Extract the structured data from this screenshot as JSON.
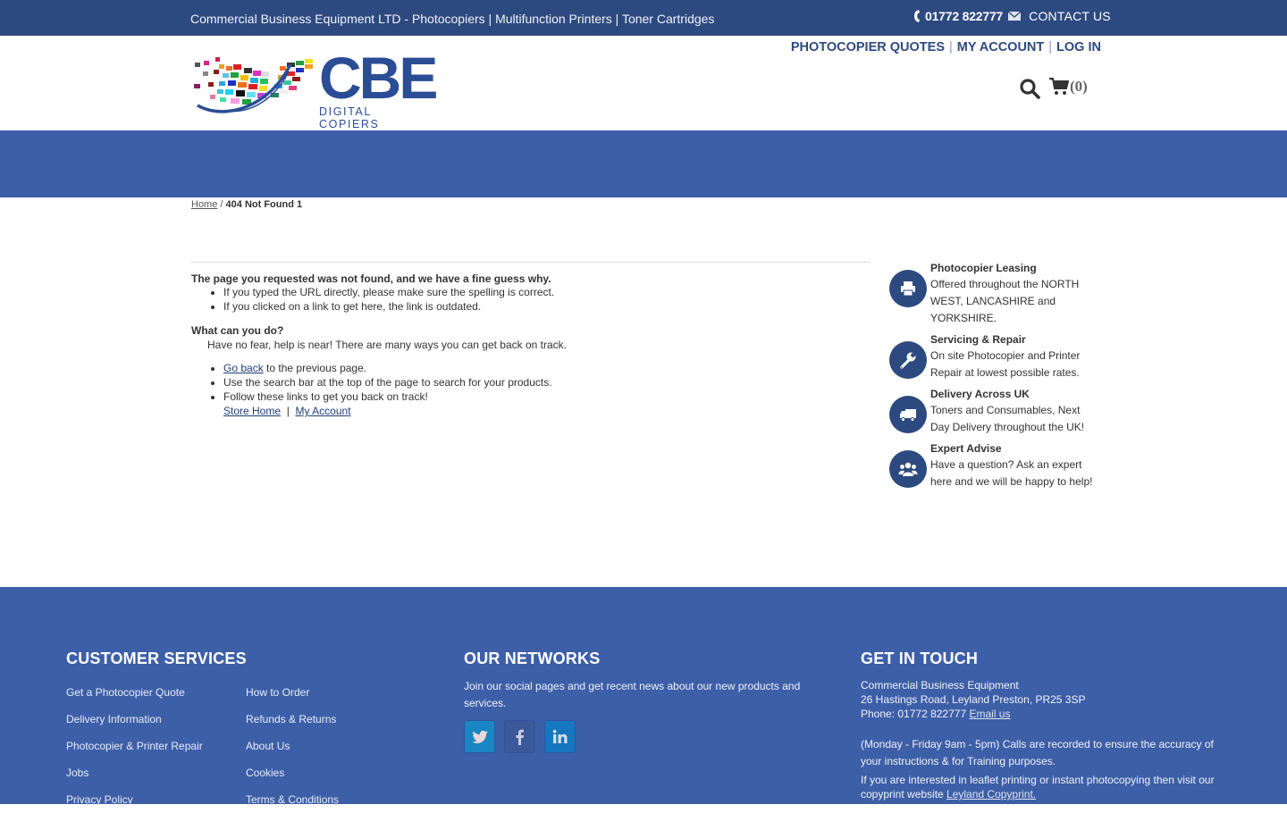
{
  "topbar": {
    "tagline": "Commercial Business Equipment LTD - Photocopiers | Multifunction Printers | Toner Cartridges",
    "phone": "01772 822777",
    "contact_label": "CONTACT US",
    "icons": {
      "phone": "phone-icon",
      "mail": "envelope-icon"
    }
  },
  "header": {
    "logo": {
      "brand": "CBE",
      "subtitle": "DIGITAL COPIERS"
    },
    "nav": [
      {
        "label": "PHOTOCOPIER QUOTES"
      },
      {
        "label": "MY ACCOUNT"
      },
      {
        "label": "LOG IN"
      }
    ],
    "separator": "|",
    "search_icon": "search-icon",
    "cart": {
      "icon": "shopping-cart-icon",
      "count": "(0)"
    }
  },
  "breadcrumb": {
    "home": "Home",
    "separator": "/",
    "current": "404 Not Found 1"
  },
  "main": {
    "heading": "The page you requested was not found, and we have a fine guess why.",
    "reasons": [
      "If you typed the URL directly, please make sure the spelling is correct.",
      "If you clicked on a link to get here, the link is outdated."
    ],
    "what_heading": "What can you do?",
    "help_text": "Have no fear, help is near! There are many ways you can get back on track.",
    "go_back_link": "Go back",
    "go_back_rest": " to the previous page.",
    "search_tip": "Use the search bar at the top of the page to search for your products.",
    "follow_tip": "Follow these links to get you back on track!",
    "store_home": "Store Home",
    "links_sep": "|",
    "my_account": "My Account"
  },
  "features": [
    {
      "icon": "printer-icon",
      "title": "Photocopier Leasing",
      "desc": "Offered throughout the NORTH WEST, LANCASHIRE and YORKSHIRE."
    },
    {
      "icon": "wrench-icon",
      "title": "Servicing & Repair",
      "desc": "On site Photocopier and Printer Repair at lowest possible rates."
    },
    {
      "icon": "truck-icon",
      "title": "Delivery Across UK",
      "desc": "Toners and Consumables, Next Day Delivery throughout the UK!"
    },
    {
      "icon": "users-icon",
      "title": "Expert Advise",
      "desc": "Have a question? Ask an expert here and we will be happy to help!"
    }
  ],
  "footer": {
    "customer_services": {
      "heading": "CUSTOMER SERVICES",
      "links": [
        "Get a Photocopier Quote",
        "How to Order",
        "Delivery Information",
        "Refunds & Returns",
        "Photocopier & Printer Repair",
        "About Us",
        "Jobs",
        "Cookies",
        "Privacy Policy",
        "Terms & Conditions"
      ]
    },
    "networks": {
      "heading": "OUR NETWORKS",
      "text": "Join our social pages and get recent news about our new products and services.",
      "socials": [
        {
          "name": "Twitter",
          "icon": "twitter-icon",
          "color": "#1a86c4"
        },
        {
          "name": "Facebook",
          "icon": "facebook-icon",
          "color": "#3b5998"
        },
        {
          "name": "LinkedIn",
          "icon": "linkedin-icon",
          "color": "#1477bf"
        }
      ]
    },
    "contact": {
      "heading": "GET IN TOUCH",
      "company": "Commercial Business Equipment",
      "address": "26 Hastings Road, Leyland Preston, PR25 3SP",
      "phone_prefix": "Phone: 01772 822777 ",
      "email_link": "Email us",
      "hours": "(Monday - Friday 9am - 5pm) Calls are recorded to ensure the accuracy of your instructions & for Training purposes.",
      "copyprint_text": "If you are interested in leaflet printing or instant photocopying then visit our copyprint website ",
      "copyprint_link": "Leyland Copyprint."
    }
  },
  "colors": {
    "topbar": "#2d4a80",
    "brand_blue": "#3d5fa8",
    "logo_blue": "#2a4d95",
    "text": "#333333"
  }
}
